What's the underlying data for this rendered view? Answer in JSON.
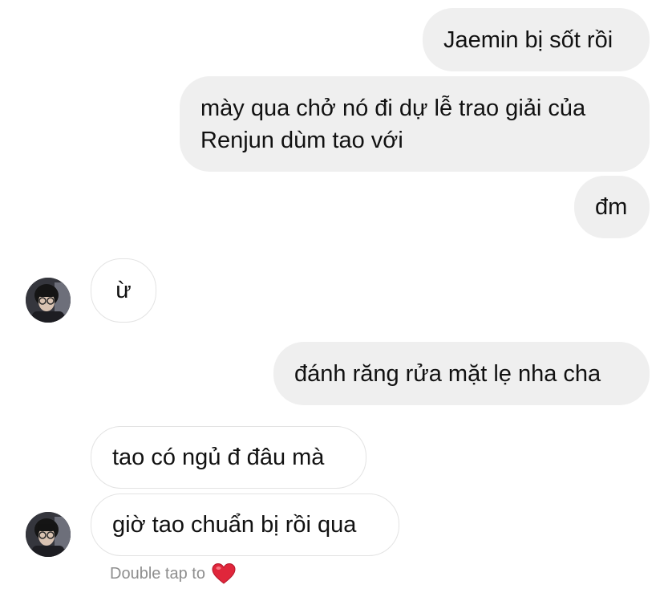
{
  "messages": [
    {
      "direction": "outgoing",
      "text": "Jaemin bị sốt rồi"
    },
    {
      "direction": "outgoing",
      "text": "mày qua chở nó đi dự lễ trao giải của\nRenjun dùm tao với"
    },
    {
      "direction": "outgoing",
      "text": "đm"
    },
    {
      "direction": "incoming",
      "text": "ừ"
    },
    {
      "direction": "outgoing",
      "text": "đánh răng rửa mặt lẹ nha cha"
    },
    {
      "direction": "incoming",
      "text": "tao có ngủ đ đâu mà"
    },
    {
      "direction": "incoming",
      "text": "giờ tao chuẩn bị rồi qua"
    }
  ],
  "hint": {
    "text": "Double tap to",
    "icon": "heart-icon",
    "icon_color": "#e0263b"
  },
  "colors": {
    "outgoing_bubble": "#efefef",
    "incoming_border": "#e3e3e3",
    "hint_text": "#8e8e8e"
  }
}
